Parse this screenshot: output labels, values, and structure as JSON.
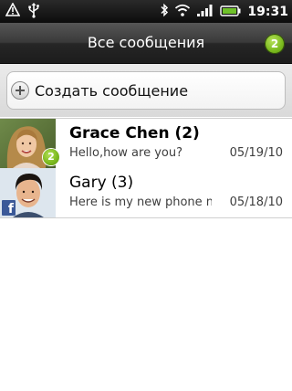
{
  "status_bar": {
    "time": "19:31",
    "icons": [
      "alert-icon",
      "usb-icon",
      "bluetooth-icon",
      "wifi-icon",
      "signal-icon",
      "battery-icon"
    ]
  },
  "title_bar": {
    "title": "Все сообщения",
    "unread_count": "2",
    "badge_color": "#7cbb1f"
  },
  "compose": {
    "label": "Создать сообщение",
    "icon": "plus-icon"
  },
  "threads": [
    {
      "name": "Grace Chen (2)",
      "preview": "Hello,how are you?",
      "date": "05/19/10",
      "unread_badge": "2",
      "bold": true,
      "avatar_icon": "contact-photo"
    },
    {
      "name": "Gary (3)",
      "preview": "Here is my new phone number",
      "date": "05/18/10",
      "bold": false,
      "source_icon": "facebook-icon",
      "avatar_icon": "contact-photo"
    }
  ],
  "colors": {
    "accent_green": "#7cbb1f",
    "facebook_blue": "#3b5998",
    "title_bar": "#2a2a2a"
  }
}
